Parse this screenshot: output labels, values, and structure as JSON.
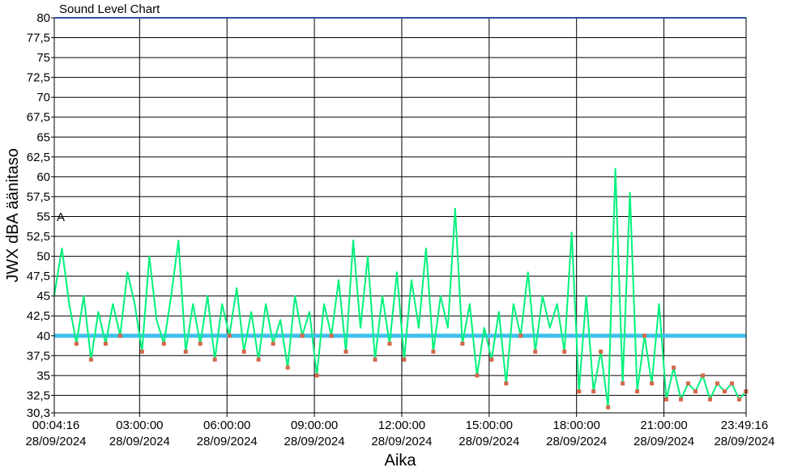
{
  "chart_data": {
    "type": "line",
    "title": "Sound Level Chart",
    "xlabel": "Aika",
    "ylabel": "JWX dBA äänitaso",
    "ylim": [
      30.3,
      80
    ],
    "y_ticks": [
      "30,3",
      "32,5",
      "35",
      "37,5",
      "40",
      "42,5",
      "45",
      "47,5",
      "50",
      "52,5",
      "55",
      "57,5",
      "60",
      "62,5",
      "65",
      "67,5",
      "70",
      "72,5",
      "75",
      "77,5",
      "80"
    ],
    "x_range": [
      "00:04:16",
      "23:49:16"
    ],
    "x_ticks": [
      {
        "time": "00:04:16",
        "date": "28/09/2024"
      },
      {
        "time": "03:00:00",
        "date": "28/09/2024"
      },
      {
        "time": "06:00:00",
        "date": "28/09/2024"
      },
      {
        "time": "09:00:00",
        "date": "28/09/2024"
      },
      {
        "time": "12:00:00",
        "date": "28/09/2024"
      },
      {
        "time": "15:00:00",
        "date": "28/09/2024"
      },
      {
        "time": "18:00:00",
        "date": "28/09/2024"
      },
      {
        "time": "21:00:00",
        "date": "28/09/2024"
      },
      {
        "time": "23:49:16",
        "date": "28/09/2024"
      }
    ],
    "grid": true,
    "threshold": {
      "value": 40,
      "color": "#3fc0ea"
    },
    "annotation": {
      "text": "A",
      "value": 52.5
    },
    "series": [
      {
        "color": "#00f27c",
        "marker_color": "#d4694c",
        "x": [
          "00:04",
          "00:20",
          "00:35",
          "00:50",
          "01:05",
          "01:20",
          "01:35",
          "01:50",
          "02:05",
          "02:20",
          "02:35",
          "02:50",
          "03:05",
          "03:20",
          "03:35",
          "03:50",
          "04:05",
          "04:20",
          "04:35",
          "04:50",
          "05:05",
          "05:20",
          "05:35",
          "05:50",
          "06:05",
          "06:20",
          "06:35",
          "06:50",
          "07:05",
          "07:20",
          "07:35",
          "07:50",
          "08:05",
          "08:20",
          "08:35",
          "08:50",
          "09:05",
          "09:20",
          "09:35",
          "09:50",
          "10:05",
          "10:20",
          "10:35",
          "10:50",
          "11:05",
          "11:20",
          "11:35",
          "11:50",
          "12:05",
          "12:20",
          "12:35",
          "12:50",
          "13:05",
          "13:20",
          "13:35",
          "13:50",
          "14:05",
          "14:20",
          "14:35",
          "14:50",
          "15:05",
          "15:20",
          "15:35",
          "15:50",
          "16:05",
          "16:20",
          "16:35",
          "16:50",
          "17:05",
          "17:20",
          "17:35",
          "17:50",
          "18:05",
          "18:20",
          "18:35",
          "18:50",
          "19:05",
          "19:20",
          "19:35",
          "19:50",
          "20:05",
          "20:20",
          "20:35",
          "20:50",
          "21:05",
          "21:20",
          "21:35",
          "21:50",
          "22:05",
          "22:20",
          "22:35",
          "22:50",
          "23:05",
          "23:20",
          "23:35",
          "23:49"
        ],
        "values": [
          45,
          51,
          44,
          39,
          45,
          37,
          43,
          39,
          44,
          40,
          48,
          44,
          38,
          50,
          42,
          39,
          45,
          52,
          38,
          44,
          39,
          45,
          37,
          44,
          40,
          46,
          38,
          43,
          37,
          44,
          39,
          42,
          36,
          45,
          40,
          43,
          35,
          44,
          40,
          47,
          38,
          52,
          41,
          50,
          37,
          45,
          39,
          48,
          37,
          47,
          41,
          51,
          38,
          45,
          41,
          56,
          39,
          44,
          35,
          41,
          37,
          43,
          34,
          44,
          40,
          48,
          38,
          45,
          41,
          44,
          38,
          53,
          33,
          45,
          33,
          38,
          31,
          61,
          34,
          58,
          33,
          40,
          34,
          44,
          32,
          36,
          32,
          34,
          33,
          35,
          32,
          34,
          33,
          34,
          32,
          33
        ]
      }
    ]
  }
}
